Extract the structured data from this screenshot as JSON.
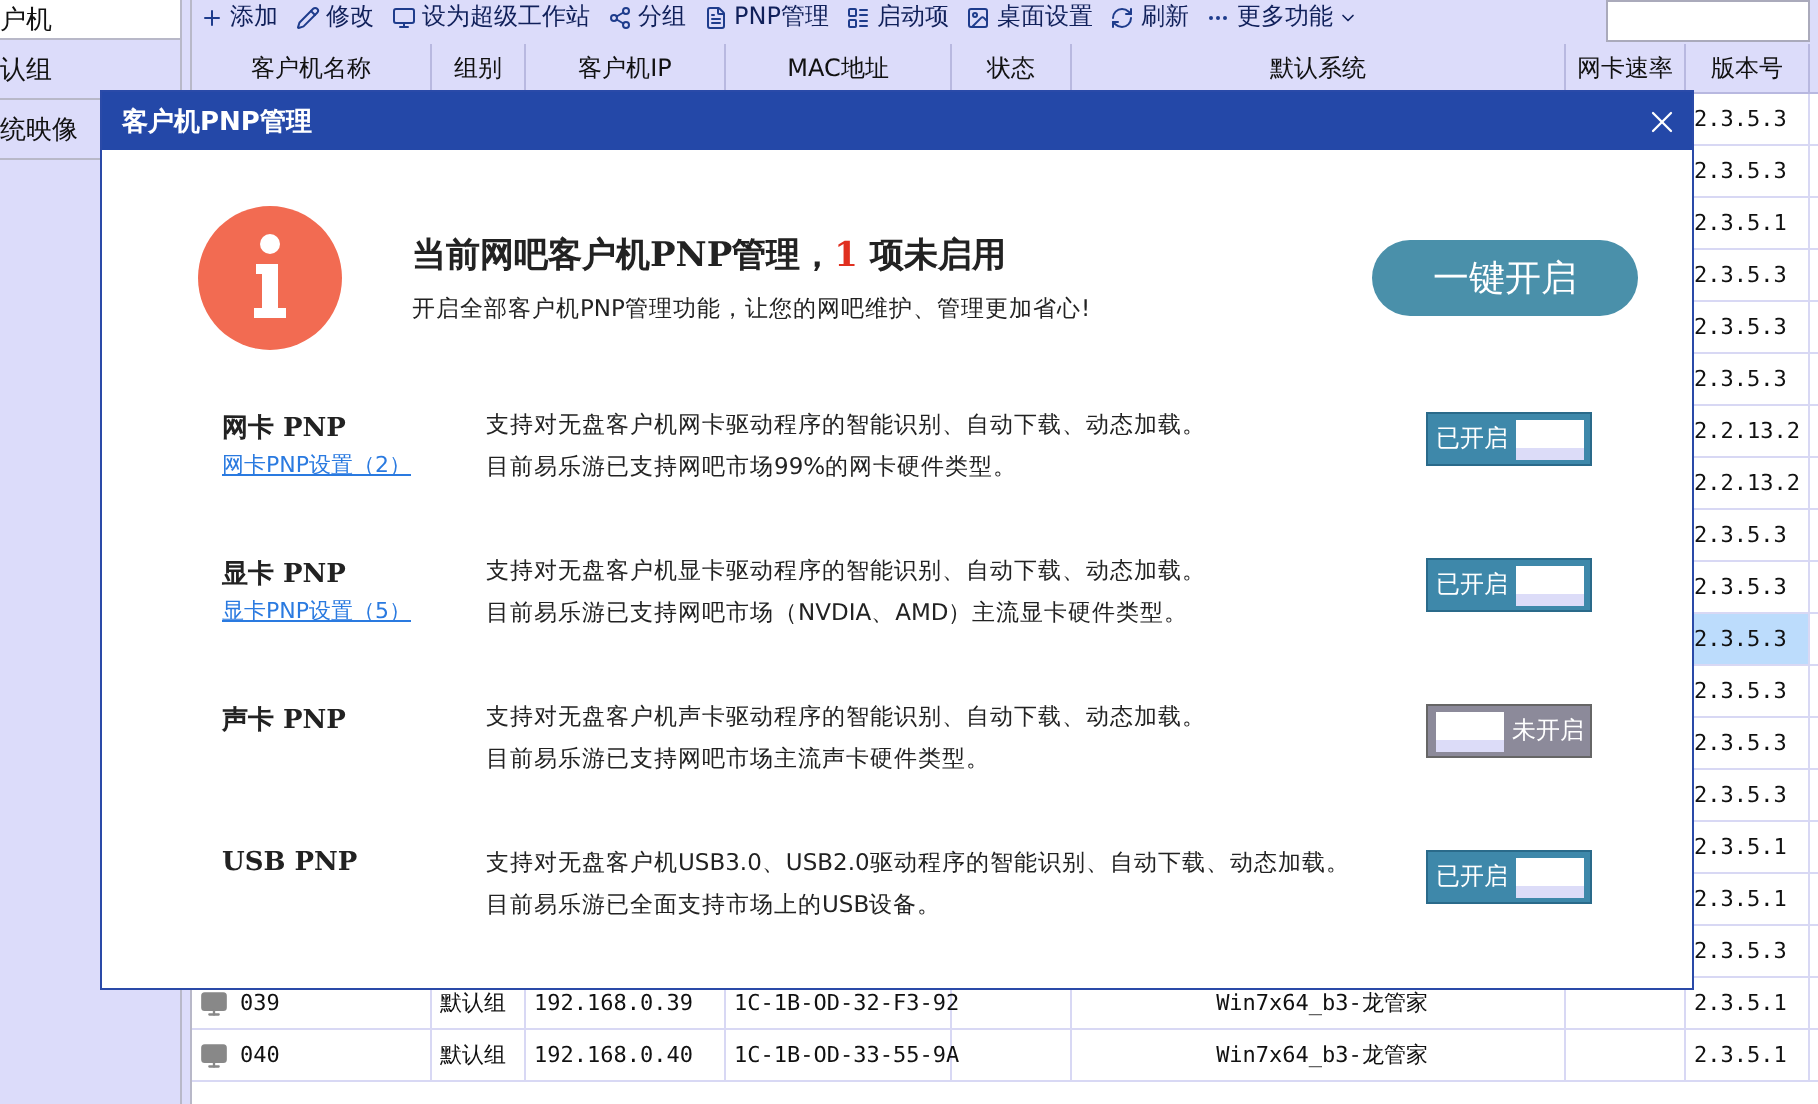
{
  "sidebar": {
    "items": [
      {
        "label": "户机",
        "selected": true
      },
      {
        "label": "认组",
        "selected": false
      },
      {
        "label": "统映像",
        "selected": false
      }
    ]
  },
  "toolbar": {
    "buttons": [
      {
        "kind": "add",
        "label": "添加"
      },
      {
        "kind": "edit",
        "label": "修改"
      },
      {
        "kind": "super",
        "label": "设为超级工作站"
      },
      {
        "kind": "group",
        "label": "分组"
      },
      {
        "kind": "pnp",
        "label": "PNP管理"
      },
      {
        "kind": "startup",
        "label": "启动项"
      },
      {
        "kind": "desktop",
        "label": "桌面设置"
      },
      {
        "kind": "refresh",
        "label": "刷新"
      },
      {
        "kind": "more",
        "label": "更多功能"
      }
    ]
  },
  "table": {
    "columns": [
      "客户机名称",
      "组别",
      "客户机IP",
      "MAC地址",
      "状态",
      "默认系统",
      "网卡速率",
      "版本号"
    ],
    "rows": [
      {
        "version": "2.3.5.3",
        "selected": false
      },
      {
        "version": "2.3.5.3",
        "selected": false
      },
      {
        "version": "2.3.5.1",
        "selected": false
      },
      {
        "version": "2.3.5.3",
        "selected": false
      },
      {
        "version": "2.3.5.3",
        "selected": false
      },
      {
        "version": "2.3.5.3",
        "selected": false
      },
      {
        "version": "2.2.13.2",
        "selected": false
      },
      {
        "version": "2.2.13.2",
        "selected": false
      },
      {
        "version": "2.3.5.3",
        "selected": false
      },
      {
        "version": "2.3.5.3",
        "selected": false
      },
      {
        "version": "2.3.5.3",
        "selected": true
      },
      {
        "version": "2.3.5.3",
        "selected": false
      },
      {
        "version": "2.3.5.3",
        "selected": false
      },
      {
        "version": "2.3.5.3",
        "selected": false
      },
      {
        "version": "2.3.5.1",
        "selected": false
      },
      {
        "version": "2.3.5.1",
        "selected": false
      },
      {
        "version": "2.3.5.3",
        "selected": false
      },
      {
        "name": "039",
        "group": "默认组",
        "ip": "192.168.0.39",
        "mac": "1C-1B-OD-32-F3-92",
        "system": "Win7x64_b3-龙管家",
        "version": "2.3.5.1",
        "selected": false
      },
      {
        "name": "040",
        "group": "默认组",
        "ip": "192.168.0.40",
        "mac": "1C-1B-OD-33-55-9A",
        "system": "Win7x64_b3-龙管家",
        "version": "2.3.5.1",
        "selected": false
      }
    ]
  },
  "dialog": {
    "title": "客户机PNP管理",
    "headline": {
      "prefix": "当前网吧客户机PNP管理，",
      "count": "1",
      "suffix": "项未启用"
    },
    "subtitle": "开启全部客户机PNP管理功能，让您的网吧维护、管理更加省心!",
    "enable_all_button": "一键开启",
    "items": [
      {
        "title": "网卡 PNP",
        "link": "网卡PNP设置（2）",
        "lines": [
          "支持对无盘客户机网卡驱动程序的智能识别、自动下载、动态加载。",
          "目前易乐游已支持网吧市场99%的网卡硬件类型。"
        ],
        "on": true,
        "toggle_label": "已开启"
      },
      {
        "title": "显卡 PNP",
        "link": "显卡PNP设置（5）",
        "lines": [
          "支持对无盘客户机显卡驱动程序的智能识别、自动下载、动态加载。",
          "目前易乐游已支持网吧市场（NVDIA、AMD）主流显卡硬件类型。"
        ],
        "on": true,
        "toggle_label": "已开启"
      },
      {
        "title": "声卡 PNP",
        "lines": [
          "支持对无盘客户机声卡驱动程序的智能识别、自动下载、动态加载。",
          "目前易乐游已支持网吧市场主流声卡硬件类型。"
        ],
        "on": false,
        "toggle_label": "未开启"
      },
      {
        "title": "USB PNP",
        "lines": [
          "支持对无盘客户机USB3.0、USB2.0驱动程序的智能识别、自动下载、动态加载。",
          "目前易乐游已全面支持市场上的USB设备。"
        ],
        "on": true,
        "toggle_label": "已开启"
      }
    ]
  }
}
